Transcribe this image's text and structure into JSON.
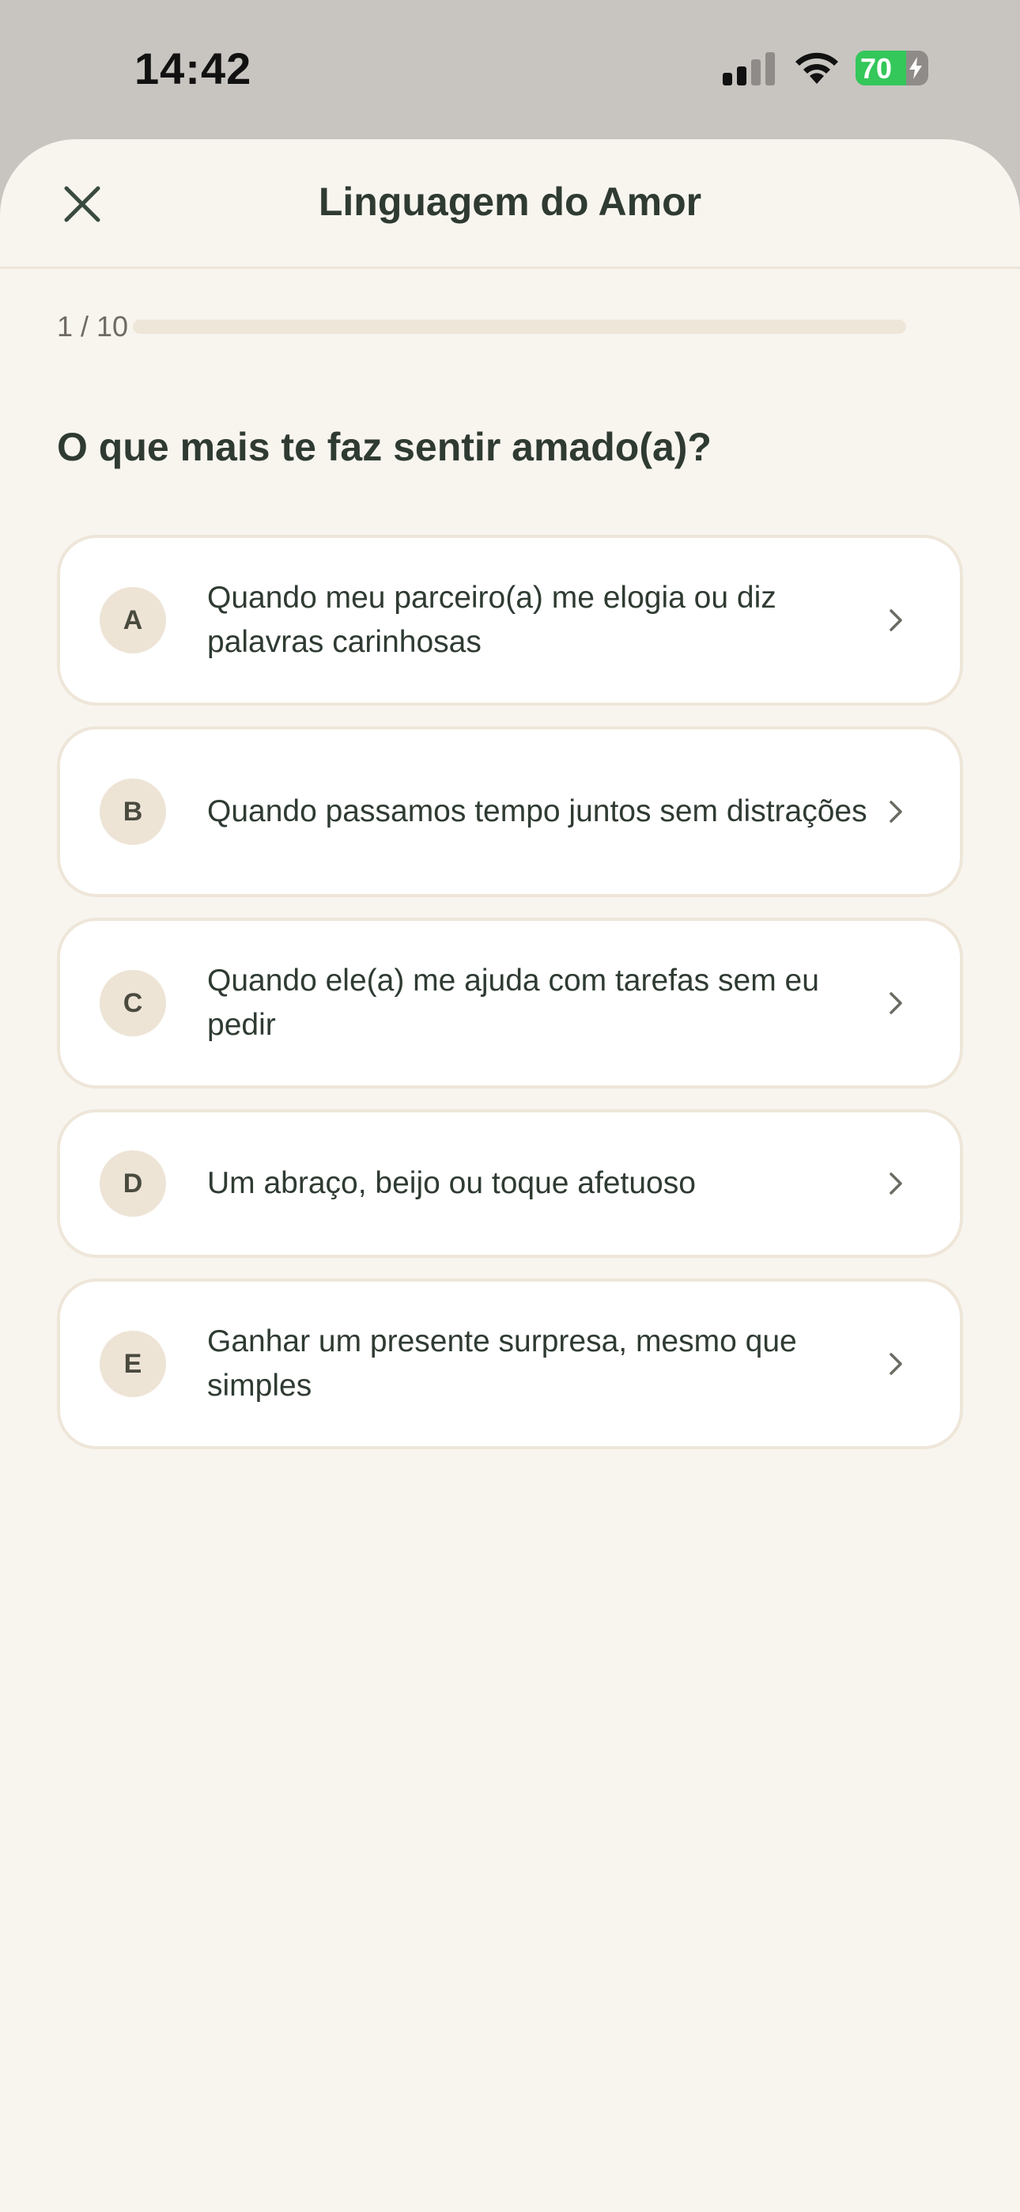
{
  "status": {
    "time": "14:42",
    "battery": "70",
    "battery_level": 0.7
  },
  "header": {
    "title": "Linguagem do Amor"
  },
  "progress": {
    "label": "1 / 10",
    "fraction": 0.0
  },
  "question": "O que mais te faz sentir amado(a)?",
  "options": [
    {
      "letter": "A",
      "text": "Quando meu parceiro(a) me elogia ou diz palavras carinhosas"
    },
    {
      "letter": "B",
      "text": "Quando passamos tempo juntos sem distrações"
    },
    {
      "letter": "C",
      "text": "Quando ele(a) me ajuda com tarefas sem eu pedir"
    },
    {
      "letter": "D",
      "text": "Um abraço, beijo ou toque afetuoso"
    },
    {
      "letter": "E",
      "text": "Ganhar um presente surpresa, mesmo que simples"
    }
  ],
  "icons": {
    "close": "close-icon",
    "chevron": "chevron-right-icon",
    "signal": "cellular-signal-icon",
    "wifi": "wifi-icon",
    "battery": "battery-icon"
  },
  "colors": {
    "background": "#f8f5ef",
    "text": "#2f3b32",
    "battery_green": "#34c759"
  }
}
